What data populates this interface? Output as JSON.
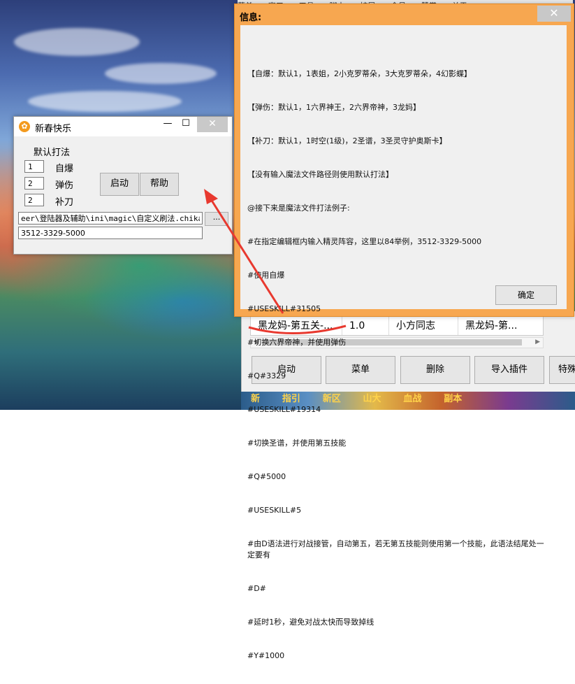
{
  "background_app": {
    "menu": [
      "菜单",
      "窗口",
      "工具",
      "脚本",
      "扩展",
      "会员",
      "赞赏",
      "关于"
    ],
    "table_row": [
      "黑龙妈-第五关-...",
      "1.0",
      "小方同志",
      "黑龙妈-第..."
    ],
    "buttons": [
      "启动",
      "菜单",
      "删除",
      "导入插件",
      "特殊"
    ],
    "banner": [
      "新",
      "指引",
      "新区",
      "山大",
      "血战",
      "副本"
    ]
  },
  "mini_window": {
    "title": "新春快乐",
    "controls": {
      "minimize": "—",
      "maximize": "☐",
      "close": "✕"
    },
    "group_label": "默认打法",
    "skills": [
      {
        "value": "1",
        "label": "自爆"
      },
      {
        "value": "2",
        "label": "弹伤"
      },
      {
        "value": "2",
        "label": "补刀"
      }
    ],
    "start_button": "启动",
    "help_button": "帮助",
    "path_value": "eer\\登陆器及辅助\\ini\\magic\\自定义刷法.chika",
    "browse_button": "...",
    "code_value": "3512-3329-5000"
  },
  "info_dialog": {
    "title": "信息:",
    "close": "✕",
    "lines": [
      "【自爆：默认1，1表姐，2小克罗蒂朵，3大克罗蒂朵，4幻影蝶】",
      "【弹伤：默认1，1六界神王，2六界帝神，3龙妈】",
      "【补刀：默认1，1时空(1级)，2圣谱，3圣灵守护奥斯卡】",
      "【没有输入魔法文件路径则使用默认打法】",
      "@接下来是魔法文件打法例子:",
      "#在指定编辑框内输入精灵阵容，这里以84举例，3512-3329-5000",
      "#使用自爆",
      "#USESKILL#31505",
      "#切换六界帝神，并使用弹伤",
      "#Q#3329",
      "#USESKILL#19314",
      "#切换圣谱，并使用第五技能",
      "#Q#5000",
      "#USESKILL#5",
      "#由D语法进行对战接管，自动第五，若无第五技能则使用第一个技能，此语法结尾处一定要有",
      "#D#",
      "#延时1秒，避免对战太快而导致掉线",
      "#Y#1000"
    ],
    "ok_button": "确定"
  },
  "colors": {
    "dialog_frame": "#f7a750",
    "annotation": "#e8392f"
  }
}
